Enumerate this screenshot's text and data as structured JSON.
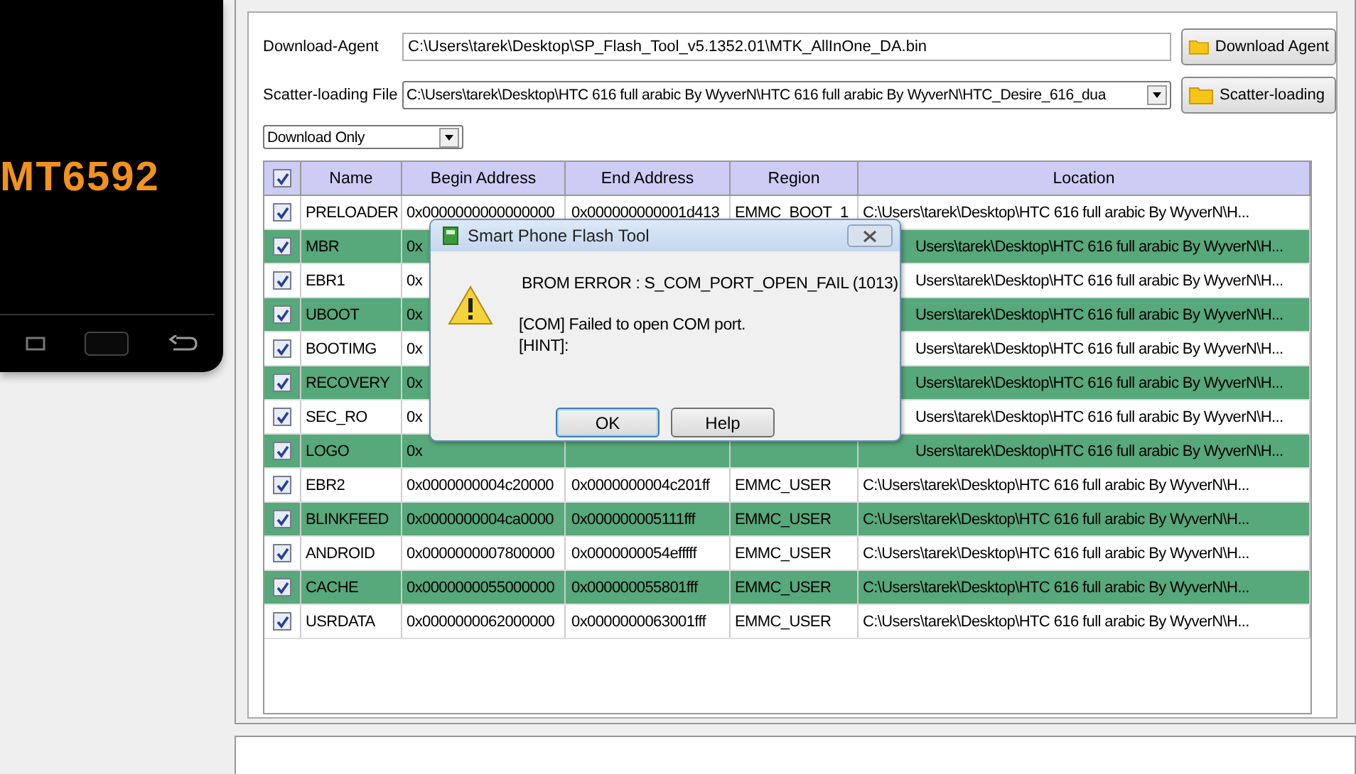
{
  "phone": {
    "chip": "MT6592"
  },
  "download_agent": {
    "label": "Download-Agent",
    "value": "C:\\Users\\tarek\\Desktop\\SP_Flash_Tool_v5.1352.01\\MTK_AllInOne_DA.bin",
    "button": "Download Agent"
  },
  "scatter_file": {
    "label": "Scatter-loading File",
    "value": "C:\\Users\\tarek\\Desktop\\HTC 616 full arabic By WyverN\\HTC 616 full arabic By WyverN\\HTC_Desire_616_dua",
    "button": "Scatter-loading"
  },
  "mode_dropdown": {
    "value": "Download Only"
  },
  "table": {
    "all_checked": true,
    "columns": [
      "Name",
      "Begin Address",
      "End Address",
      "Region",
      "Location"
    ],
    "rows": [
      {
        "checked": true,
        "selected": false,
        "covered": false,
        "name": "PRELOADER",
        "begin": "0x0000000000000000",
        "end": "0x000000000001d413",
        "region": "EMMC_BOOT_1",
        "location": "C:\\Users\\tarek\\Desktop\\HTC 616 full arabic By WyverN\\H..."
      },
      {
        "checked": true,
        "selected": true,
        "covered": true,
        "name": "MBR",
        "begin": "0x",
        "location": "Users\\tarek\\Desktop\\HTC 616 full arabic By WyverN\\H..."
      },
      {
        "checked": true,
        "selected": false,
        "covered": true,
        "name": "EBR1",
        "begin": "0x",
        "location": "Users\\tarek\\Desktop\\HTC 616 full arabic By WyverN\\H..."
      },
      {
        "checked": true,
        "selected": true,
        "covered": true,
        "name": "UBOOT",
        "begin": "0x",
        "location": "Users\\tarek\\Desktop\\HTC 616 full arabic By WyverN\\H..."
      },
      {
        "checked": true,
        "selected": false,
        "covered": true,
        "name": "BOOTIMG",
        "begin": "0x",
        "location": "Users\\tarek\\Desktop\\HTC 616 full arabic By WyverN\\H..."
      },
      {
        "checked": true,
        "selected": true,
        "covered": true,
        "name": "RECOVERY",
        "begin": "0x",
        "location": "Users\\tarek\\Desktop\\HTC 616 full arabic By WyverN\\H..."
      },
      {
        "checked": true,
        "selected": false,
        "covered": true,
        "name": "SEC_RO",
        "begin": "0x",
        "location": "Users\\tarek\\Desktop\\HTC 616 full arabic By WyverN\\H..."
      },
      {
        "checked": true,
        "selected": true,
        "covered": true,
        "name": "LOGO",
        "begin": "0x",
        "location": "Users\\tarek\\Desktop\\HTC 616 full arabic By WyverN\\H..."
      },
      {
        "checked": true,
        "selected": false,
        "covered": false,
        "name": "EBR2",
        "begin": "0x0000000004c20000",
        "end": "0x0000000004c201ff",
        "region": "EMMC_USER",
        "location": "C:\\Users\\tarek\\Desktop\\HTC 616 full arabic By WyverN\\H..."
      },
      {
        "checked": true,
        "selected": true,
        "covered": false,
        "name": "BLINKFEED",
        "begin": "0x0000000004ca0000",
        "end": "0x000000005111fff",
        "region": "EMMC_USER",
        "location": "C:\\Users\\tarek\\Desktop\\HTC 616 full arabic By WyverN\\H..."
      },
      {
        "checked": true,
        "selected": false,
        "covered": false,
        "name": "ANDROID",
        "begin": "0x0000000007800000",
        "end": "0x0000000054efffff",
        "region": "EMMC_USER",
        "location": "C:\\Users\\tarek\\Desktop\\HTC 616 full arabic By WyverN\\H..."
      },
      {
        "checked": true,
        "selected": true,
        "covered": false,
        "name": "CACHE",
        "begin": "0x0000000055000000",
        "end": "0x000000055801fff",
        "region": "EMMC_USER",
        "location": "C:\\Users\\tarek\\Desktop\\HTC 616 full arabic By WyverN\\H..."
      },
      {
        "checked": true,
        "selected": false,
        "covered": false,
        "name": "USRDATA",
        "begin": "0x0000000062000000",
        "end": "0x0000000063001fff",
        "region": "EMMC_USER",
        "location": "C:\\Users\\tarek\\Desktop\\HTC 616 full arabic By WyverN\\H..."
      }
    ]
  },
  "dialog": {
    "title": "Smart Phone Flash Tool",
    "error": "BROM ERROR : S_COM_PORT_OPEN_FAIL (1013)",
    "message": "[COM] Failed to open COM port.",
    "hint": "[HINT]:",
    "buttons": [
      "OK",
      "Help"
    ]
  }
}
